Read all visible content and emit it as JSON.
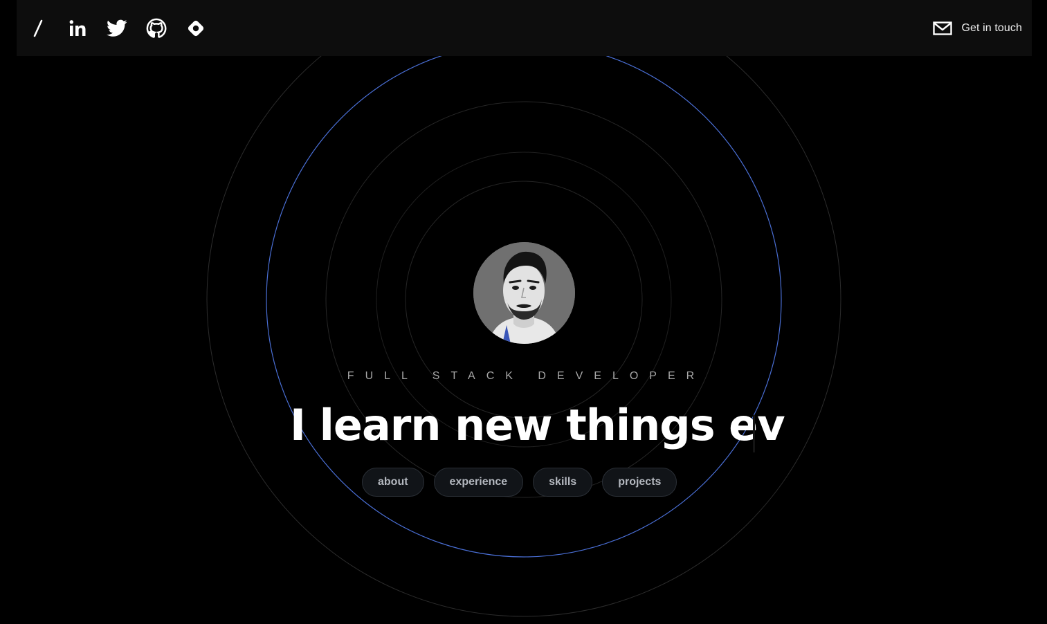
{
  "header": {
    "socials": [
      {
        "icon": "slash-icon"
      },
      {
        "icon": "linkedin-icon"
      },
      {
        "icon": "twitter-icon"
      },
      {
        "icon": "github-icon"
      },
      {
        "icon": "link-icon"
      }
    ],
    "contact_label": "Get in touch",
    "contact_icon": "mail-icon"
  },
  "hero": {
    "role": "FULL STACK DEVELOPER",
    "headline": "I learn new things ev",
    "avatar_icon": "profile-avatar"
  },
  "nav": {
    "items": [
      {
        "label": "about"
      },
      {
        "label": "experience"
      },
      {
        "label": "skills"
      },
      {
        "label": "projects"
      }
    ]
  },
  "colors": {
    "background": "#000000",
    "accent_ring": "#4a6fd6",
    "ring": "#2a2a2a",
    "pill_bg": "#111418",
    "pill_text": "#b4b8bf"
  }
}
